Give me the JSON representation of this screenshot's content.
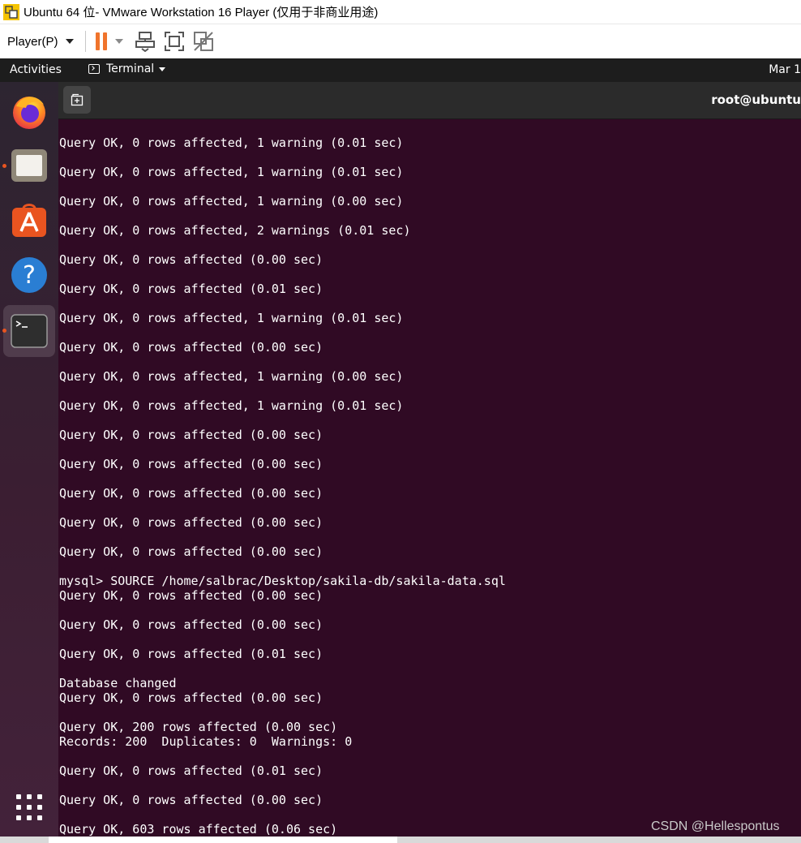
{
  "window": {
    "title": "Ubuntu 64 位- VMware Workstation 16 Player (仅用于非商业用途)"
  },
  "toolbar": {
    "player_menu_label": "Player(P)",
    "icons": [
      "pause-icon",
      "send-ctrl-alt-del-icon",
      "fullscreen-icon",
      "unity-icon"
    ]
  },
  "ubuntu_bar": {
    "activities_label": "Activities",
    "app_menu_label": "Terminal",
    "clock_text": "Mar 1"
  },
  "dock": {
    "items": [
      "firefox-icon",
      "files-icon",
      "software-icon",
      "help-icon",
      "terminal-icon"
    ],
    "show_apps_icon": "apps-grid-icon"
  },
  "terminal": {
    "title": "root@ubuntu",
    "lines": [
      "Query OK, 0 rows affected, 1 warning (0.01 sec)",
      "Query OK, 0 rows affected, 1 warning (0.01 sec)",
      "Query OK, 0 rows affected, 1 warning (0.00 sec)",
      "Query OK, 0 rows affected, 2 warnings (0.01 sec)",
      "Query OK, 0 rows affected (0.00 sec)",
      "Query OK, 0 rows affected (0.01 sec)",
      "Query OK, 0 rows affected, 1 warning (0.01 sec)",
      "Query OK, 0 rows affected (0.00 sec)",
      "Query OK, 0 rows affected, 1 warning (0.00 sec)",
      "Query OK, 0 rows affected, 1 warning (0.01 sec)",
      "Query OK, 0 rows affected (0.00 sec)",
      "Query OK, 0 rows affected (0.00 sec)",
      "Query OK, 0 rows affected (0.00 sec)",
      "Query OK, 0 rows affected (0.00 sec)",
      "Query OK, 0 rows affected (0.00 sec)",
      "mysql> SOURCE /home/salbrac/Desktop/sakila-db/sakila-data.sql",
      "Query OK, 0 rows affected (0.00 sec)",
      "Query OK, 0 rows affected (0.00 sec)",
      "Query OK, 0 rows affected (0.01 sec)",
      "Database changed",
      "Query OK, 0 rows affected (0.00 sec)",
      "Query OK, 200 rows affected (0.00 sec)",
      "Records: 200  Duplicates: 0  Warnings: 0",
      "Query OK, 0 rows affected (0.01 sec)",
      "Query OK, 0 rows affected (0.00 sec)",
      "Query OK, 603 rows affected (0.06 sec)"
    ]
  },
  "watermark": "CSDN @Hellespontus",
  "colors": {
    "terminal_bg": "#300a24",
    "ubuntu_orange": "#e95420",
    "pause_orange": "#f0742c"
  }
}
